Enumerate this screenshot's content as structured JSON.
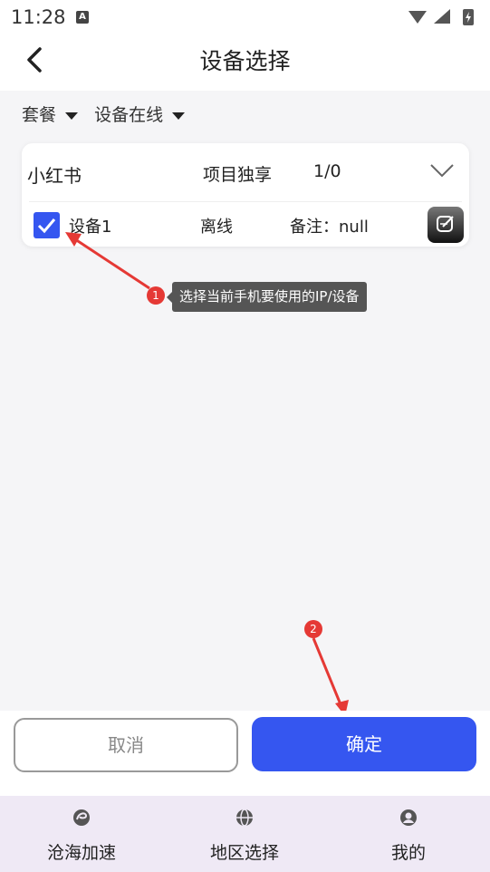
{
  "statusbar": {
    "time": "11:28",
    "notif_letter": "A"
  },
  "header": {
    "title": "设备选择"
  },
  "filters": [
    {
      "label": "套餐"
    },
    {
      "label": "设备在线"
    }
  ],
  "card": {
    "name": "小红书",
    "type": "项目独享",
    "count": "1/0",
    "device": {
      "name": "设备1",
      "status": "离线",
      "remark": "备注：null",
      "checked": true
    }
  },
  "annotations": [
    {
      "number": "1",
      "text": "选择当前手机要使用的IP/设备"
    },
    {
      "number": "2"
    }
  ],
  "actions": {
    "cancel_label": "取消",
    "confirm_label": "确定"
  },
  "tabs": [
    {
      "label": "沧海加速",
      "icon": "accelerate-icon"
    },
    {
      "label": "地区选择",
      "icon": "globe-icon"
    },
    {
      "label": "我的",
      "icon": "user-icon"
    }
  ],
  "colors": {
    "accent": "#3556f0",
    "badge": "#e53935",
    "tabbar_bg": "#efe9f5"
  }
}
